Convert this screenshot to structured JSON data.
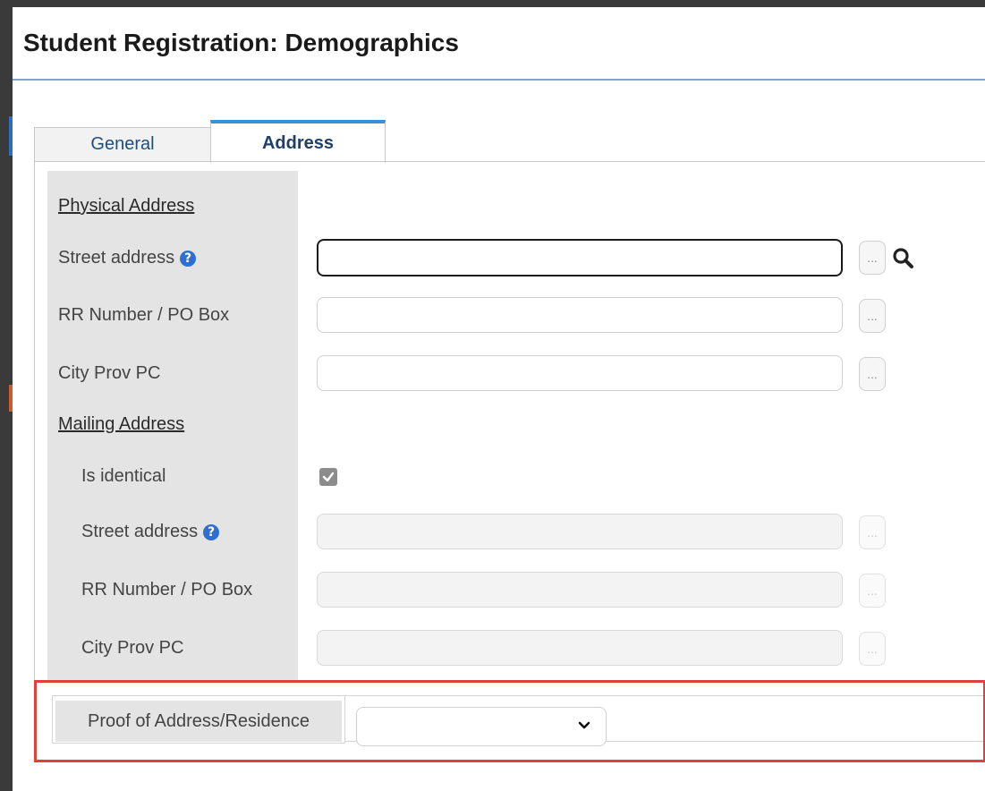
{
  "page": {
    "title": "Student Registration: Demographics"
  },
  "tabs": [
    {
      "label": "General",
      "active": false
    },
    {
      "label": "Address",
      "active": true
    }
  ],
  "physical": {
    "section_label": "Physical Address",
    "street_label": "Street address",
    "street_value": "",
    "rr_label": "RR Number / PO Box",
    "rr_value": "",
    "city_label": "City Prov PC",
    "city_value": ""
  },
  "mailing": {
    "section_label": "Mailing Address",
    "identical_label": "Is identical",
    "identical_checked": true,
    "street_label": "Street address",
    "street_value": "",
    "rr_label": "RR Number / PO Box",
    "rr_value": "",
    "city_label": "City Prov PC",
    "city_value": ""
  },
  "ellipsis": "...",
  "help_glyph": "?",
  "proof": {
    "label": "Proof of Address/Residence",
    "selected": ""
  },
  "colors": {
    "accent_tab": "#3a8fd6",
    "help_icon": "#2f6fd1",
    "highlight_box": "#e0413a"
  },
  "icons": {
    "help": "question-circle-icon",
    "search": "magnifier-icon",
    "select": "chevron-down-icon",
    "checkbox": "check-icon"
  }
}
